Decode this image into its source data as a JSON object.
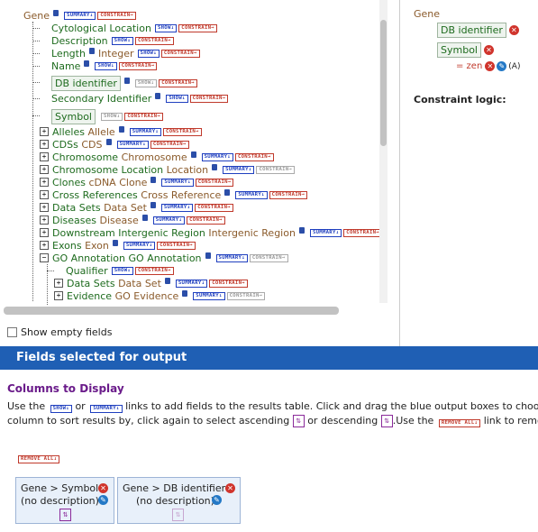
{
  "tree": {
    "root": {
      "label": "Gene"
    },
    "attributes": [
      {
        "label": "Cytological Location",
        "type": "",
        "tags": [
          "SHOW↓",
          "CONSTRAIN→"
        ]
      },
      {
        "label": "Description",
        "type": "",
        "tags": [
          "SHOW↓",
          "CONSTRAIN→"
        ]
      },
      {
        "label": "Length",
        "type": "Integer",
        "tags": [
          "SHOW↓",
          "CONSTRAIN→"
        ]
      },
      {
        "label": "Name",
        "type": "",
        "tags": [
          "SHOW↓",
          "CONSTRAIN→"
        ]
      },
      {
        "label": "DB identifier",
        "type": "",
        "tags": [
          "SHOW↓",
          "CONSTRAIN→"
        ]
      },
      {
        "label": "Secondary Identifier",
        "type": "",
        "tags": [
          "SHOW↓",
          "CONSTRAIN→"
        ]
      },
      {
        "label": "Symbol",
        "type": "",
        "tags": [
          "SHOW↓",
          "CONSTRAIN→"
        ]
      }
    ],
    "references": [
      {
        "label": "Alleles",
        "type": "Allele"
      },
      {
        "label": "CDSs",
        "type": "CDS"
      },
      {
        "label": "Chromosome",
        "type": "Chromosome"
      },
      {
        "label": "Chromosome Location",
        "type": "Location"
      },
      {
        "label": "Clones",
        "type": "cDNA Clone"
      },
      {
        "label": "Cross References",
        "type": "Cross Reference"
      },
      {
        "label": "Data Sets",
        "type": "Data Set"
      },
      {
        "label": "Diseases",
        "type": "Disease"
      },
      {
        "label": "Downstream Intergenic Region",
        "type": "Intergenic Region"
      },
      {
        "label": "Exons",
        "type": "Exon"
      },
      {
        "label": "GO Annotation",
        "type": "GO Annotation"
      }
    ],
    "go_children": [
      {
        "label": "Qualifier",
        "type": ""
      },
      {
        "label": "Data Sets",
        "type": "Data Set"
      },
      {
        "label": "Evidence",
        "type": "GO Evidence"
      }
    ],
    "tags": {
      "summary": "SUMMARY↓",
      "show": "SHOW↓",
      "constrain": "CONSTRAIN→",
      "expand": "+",
      "collapse": "−"
    }
  },
  "right_panel": {
    "root": "Gene",
    "constraints": [
      "DB identifier",
      "Symbol"
    ],
    "constraint_value": "= zen",
    "constraint_code": "(A)",
    "logic_label": "Constraint logic:"
  },
  "show_empty": {
    "label": "Show empty fields",
    "checked": false
  },
  "output_header": "Fields selected for output",
  "columns": {
    "title": "Columns to Display",
    "desc_use": "Use the",
    "desc_or": "or",
    "desc_mid": "links to add fields to the results table. Click and drag the blue output boxes to choo",
    "desc_line2a": "column to sort results by, click again to select ascending",
    "desc_line2b": "or descending",
    "desc_line2c": ".Use the",
    "desc_line2d": "link to remov",
    "remove_all": "REMOVE ALL↓",
    "tag_show": "SHOW↓",
    "tag_summary": "SUMMARY↓"
  },
  "outputs": [
    {
      "path": "Gene > Symbol",
      "note": "(no description)"
    },
    {
      "path": "Gene > DB identifier",
      "note": "(no description)"
    }
  ],
  "icons": {
    "remove": "x-circle-icon",
    "edit": "edit-icon",
    "sort": "sort-icon",
    "note": "note-icon"
  }
}
